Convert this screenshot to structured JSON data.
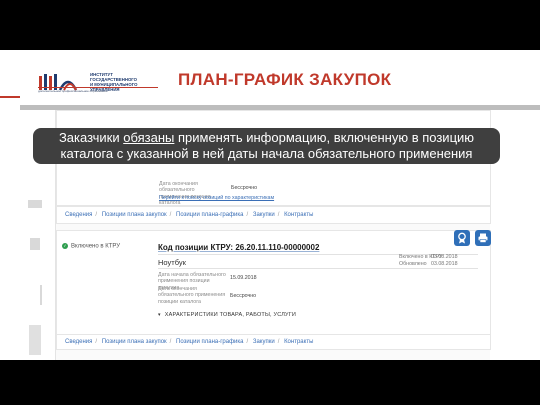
{
  "logo": {
    "org_name": "ИНСТИТУТ ГОСУДАРСТВЕННОГО И МУНИЦИПАЛЬНОГО УПРАВЛЕНИЯ",
    "tagline": "дополнительное профессиональное образование"
  },
  "title": "ПЛАН-ГРАФИК ЗАКУПОК",
  "callout": {
    "prefix": "Заказчики ",
    "emphasis": "обязаны",
    "suffix": " применять информацию, включенную в позицию каталога с указанной в ней даты начала обязательного применения"
  },
  "top_item": {
    "date_end_label": "Дата окончания обязательного применения позиции каталога",
    "date_end_value": "Бессрочно",
    "search_link": "Перейти к поиску позиций по характеристикам"
  },
  "nav_top": [
    "Сведения",
    "Позиции плана закупок",
    "Позиции плана-графика",
    "Закупки",
    "Контракты"
  ],
  "item": {
    "status": "Включено в КТРУ",
    "ktru_code": "Код позиции КТРУ: 26.20.11.110-00000002",
    "product": "Ноутбук",
    "date_start_label": "Дата начала обязательного применения позиции каталога",
    "date_start_value": "15.09.2018",
    "date_end_label": "Дата окончания обязательного применения позиции каталога",
    "date_end_value": "Бессрочно",
    "characteristics": "ХАРАКТЕРИСТИКИ ТОВАРА, РАБОТЫ, УСЛУГИ",
    "included_label": "Включено в КТРУ",
    "included_value": "03.08.2018",
    "updated_label": "Обновлено",
    "updated_value": "03.08.2018"
  },
  "nav_bottom": [
    "Сведения",
    "Позиции плана закупок",
    "Позиции плана-графика",
    "Закупки",
    "Контракты"
  ],
  "colors": {
    "accent_red": "#c0392b",
    "link_blue": "#3b6fb6",
    "callout_bg": "#3f3f3f",
    "status_green": "#2e9e4f"
  }
}
